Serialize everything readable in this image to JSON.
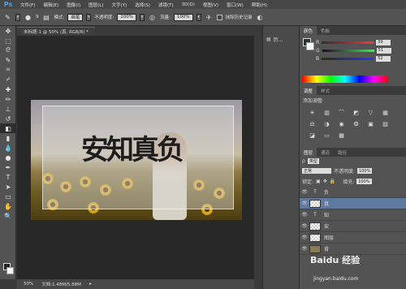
{
  "app": {
    "logo": "Ps"
  },
  "menu": [
    "文件(F)",
    "编辑(E)",
    "图像(I)",
    "图层(L)",
    "文字(Y)",
    "选择(S)",
    "滤镜(T)",
    "3D(D)",
    "视图(V)",
    "窗口(W)",
    "帮助(H)"
  ],
  "options": {
    "size_value": "9",
    "mode_label": "模式:",
    "mode_value": "画笔",
    "opacity_label": "不透明度:",
    "opacity_value": "100%",
    "flow_label": "流量:",
    "flow_value": "100%",
    "erase_history_label": "抹除历史记录"
  },
  "document": {
    "tab_title": "未标题-1 @ 50% (真, RGB/8) *",
    "overlay_text": "安知真负",
    "zoom": "50%",
    "doc_size": "文档:1.48M/5.88M"
  },
  "side_column": {
    "history_label": "历..."
  },
  "color_panel": {
    "tabs": [
      "颜色",
      "色板"
    ],
    "channels": [
      {
        "label": "R",
        "value": "39",
        "color": "#d23030"
      },
      {
        "label": "G",
        "value": "51",
        "color": "#2fa73a"
      },
      {
        "label": "B",
        "value": "52",
        "color": "#2c4fcf"
      }
    ]
  },
  "adjust_panel": {
    "tabs": [
      "调整",
      "样式"
    ],
    "title": "添加调整",
    "icons": [
      "brightness-icon",
      "levels-icon",
      "curves-icon",
      "exposure-icon",
      "vibrance-icon",
      "hsl-icon",
      "color-balance-icon",
      "bw-icon",
      "photo-filter-icon",
      "channel-mixer-icon",
      "invert-icon",
      "posterize-icon",
      "threshold-icon",
      "gradient-map-icon",
      "selective-color-icon"
    ]
  },
  "layers_panel": {
    "tabs": [
      "图层",
      "通道",
      "路径"
    ],
    "kind_value": "类型",
    "blend_mode": "正常",
    "opacity_label": "不透明度:",
    "opacity_value": "100%",
    "lock_label": "锁定:",
    "fill_label": "填充:",
    "fill_value": "100%",
    "layers": [
      {
        "type": "text",
        "name": "负",
        "selected": false
      },
      {
        "type": "raster",
        "name": "真",
        "selected": true
      },
      {
        "type": "text",
        "name": "知",
        "selected": false
      },
      {
        "type": "raster",
        "name": "安",
        "selected": false
      },
      {
        "type": "raster",
        "name": "图层",
        "selected": false
      },
      {
        "type": "raster",
        "name": "背",
        "selected": false
      }
    ]
  },
  "watermark": {
    "text": "Baidu 经验",
    "url": "jingyan.baidu.com"
  }
}
